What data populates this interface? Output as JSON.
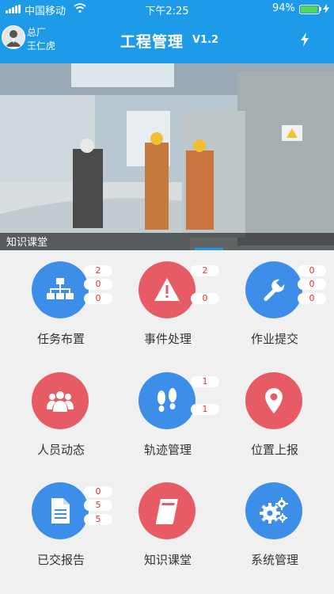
{
  "status_bar": {
    "carrier": "中国移动",
    "time": "下午2:25",
    "battery": "94%",
    "battery_level": 0.94
  },
  "header": {
    "org": "总厂",
    "user": "王仁虎",
    "title": "工程管理",
    "version": "V1.2"
  },
  "banner": {
    "caption": "知识课堂"
  },
  "menu": [
    {
      "label": "任务布置",
      "color": "#3d8ee8",
      "icon": "org-chart-icon",
      "badges": [
        "2",
        "0",
        "0"
      ]
    },
    {
      "label": "事件处理",
      "color": "#e65b64",
      "icon": "warning-icon",
      "badges": [
        "2",
        "0"
      ]
    },
    {
      "label": "作业提交",
      "color": "#3d8ee8",
      "icon": "wrench-icon",
      "badges": [
        "0",
        "0",
        "0"
      ]
    },
    {
      "label": "人员动态",
      "color": "#e65b64",
      "icon": "people-icon",
      "badges": []
    },
    {
      "label": "轨迹管理",
      "color": "#3d8ee8",
      "icon": "footprints-icon",
      "badges": [
        "1",
        "1"
      ]
    },
    {
      "label": "位置上报",
      "color": "#e65b64",
      "icon": "location-pin-icon",
      "badges": []
    },
    {
      "label": "已交报告",
      "color": "#3d8ee8",
      "icon": "document-icon",
      "badges": [
        "0",
        "5",
        "5"
      ]
    },
    {
      "label": "知识课堂",
      "color": "#e65b64",
      "icon": "book-icon",
      "badges": []
    },
    {
      "label": "系统管理",
      "color": "#3d8ee8",
      "icon": "gears-icon",
      "badges": []
    }
  ]
}
